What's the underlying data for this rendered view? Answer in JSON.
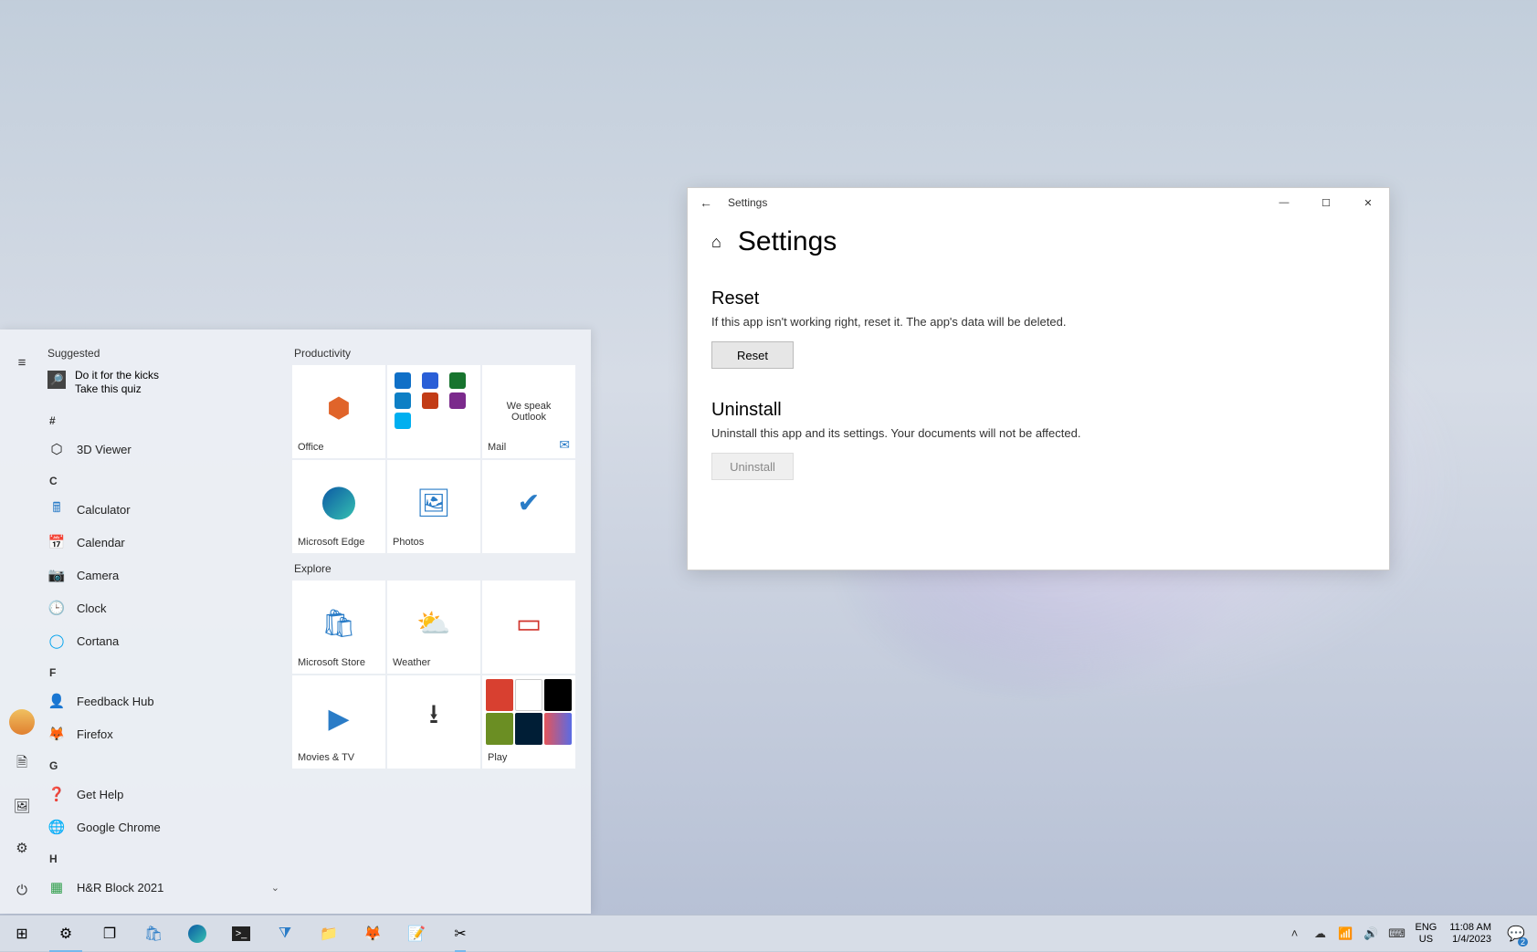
{
  "settings_window": {
    "titlebar_title": "Settings",
    "page_heading": "Settings",
    "sections": {
      "reset": {
        "heading": "Reset",
        "description": "If this app isn't working right, reset it. The app's data will be deleted.",
        "button_label": "Reset"
      },
      "uninstall": {
        "heading": "Uninstall",
        "description": "Uninstall this app and its settings. Your documents will not be affected.",
        "button_label": "Uninstall"
      }
    }
  },
  "start_menu": {
    "suggested_header": "Suggested",
    "suggested_item": {
      "line1": "Do it for the kicks",
      "line2": "Take this quiz"
    },
    "letter_headers": {
      "hash": "#",
      "c": "C",
      "f": "F",
      "g": "G",
      "h": "H"
    },
    "apps": {
      "viewer3d": "3D Viewer",
      "calculator": "Calculator",
      "calendar": "Calendar",
      "camera": "Camera",
      "clock": "Clock",
      "cortana": "Cortana",
      "feedback": "Feedback Hub",
      "firefox": "Firefox",
      "gethelp": "Get Help",
      "chrome": "Google Chrome",
      "hrblock": "H&R Block 2021"
    },
    "group_productivity": "Productivity",
    "group_explore": "Explore",
    "tiles": {
      "office": "Office",
      "edge": "Microsoft Edge",
      "photos": "Photos",
      "wespeak_line1": "We speak",
      "wespeak_line2": "Outlook",
      "mail": "Mail",
      "store": "Microsoft Store",
      "weather": "Weather",
      "movies": "Movies & TV",
      "play": "Play"
    }
  },
  "taskbar": {
    "lang_top": "ENG",
    "lang_bottom": "US",
    "time": "11:08 AM",
    "date": "1/4/2023",
    "notification_count": "2"
  }
}
